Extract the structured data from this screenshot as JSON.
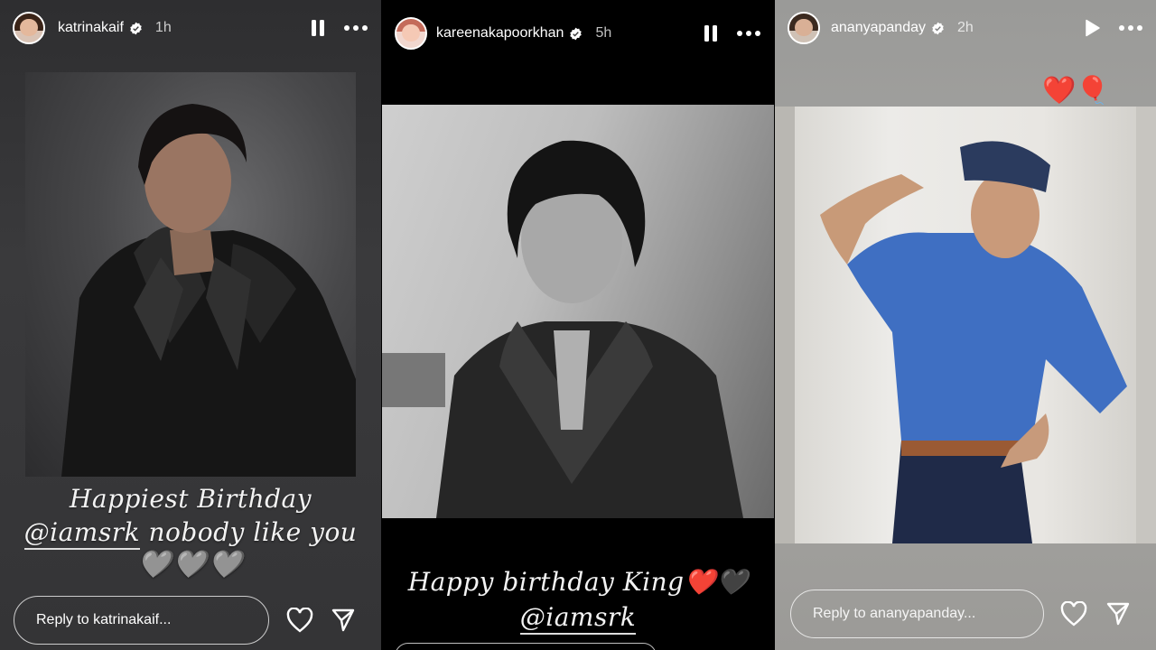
{
  "stories": [
    {
      "username": "katrinakaif",
      "time": "1h",
      "playback_icon": "pause-icon",
      "caption_line1": "Happiest Birthday",
      "caption_mention": "@iamsrk",
      "caption_line2_rest": " nobody like you",
      "caption_hearts": "🩶🩶🩶",
      "reply_placeholder": "Reply to katrinakaif..."
    },
    {
      "username": "kareenakapoorkhan",
      "time": "5h",
      "playback_icon": "pause-icon",
      "caption_line1": "Happy birthday King❤️🖤",
      "caption_mention": "@iamsrk"
    },
    {
      "username": "ananyapanday",
      "time": "2h",
      "playback_icon": "play-icon",
      "stickers": "❤️🎈",
      "reply_placeholder": "Reply to ananyapanday..."
    }
  ],
  "colors": {
    "verified_badge": "#ffffff",
    "story1_bg": "#343436",
    "story2_bg": "#000000",
    "story3_bg": "#a19f9c"
  }
}
